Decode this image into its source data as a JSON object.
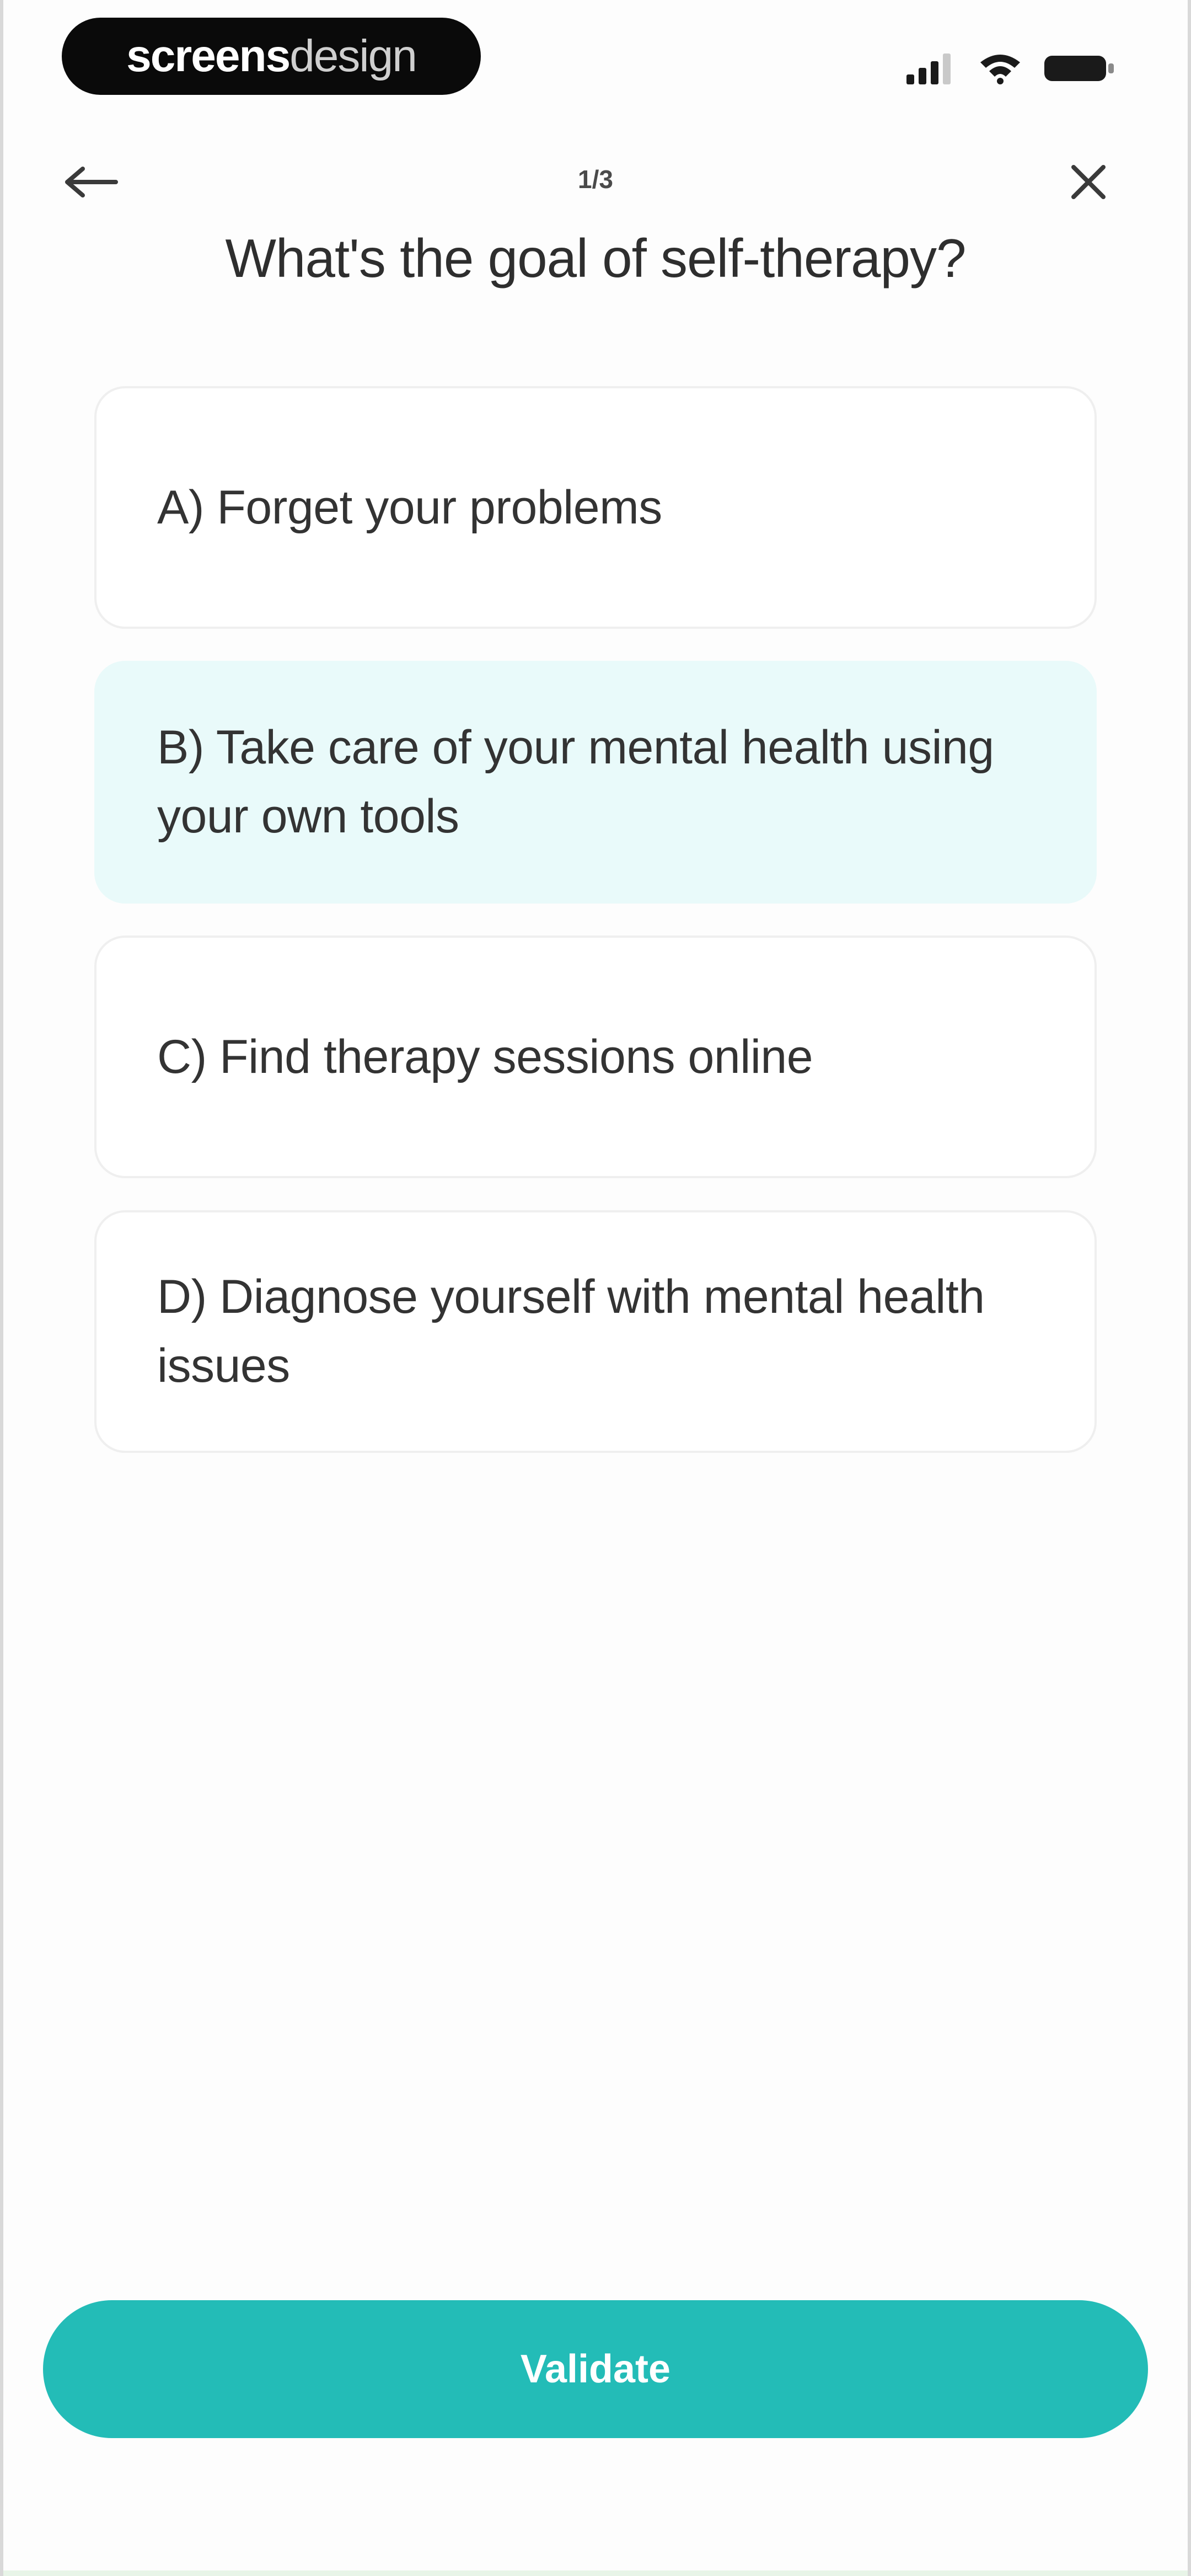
{
  "status_bar": {
    "watermark_part1": "screens",
    "watermark_part2": "design",
    "icons": [
      "signal-icon",
      "wifi-icon",
      "battery-icon"
    ]
  },
  "header": {
    "back_icon": "arrow-left-icon",
    "close_icon": "close-icon",
    "progress": "1/3"
  },
  "question": "What's the goal of self-therapy?",
  "options": [
    {
      "label": "A) Forget your problems",
      "selected": false
    },
    {
      "label": "B) Take care of your mental health using your own tools",
      "selected": true
    },
    {
      "label": "C) Find therapy sessions online",
      "selected": false
    },
    {
      "label": "D) Diagnose yourself with mental health issues",
      "selected": false
    }
  ],
  "validate_label": "Validate",
  "colors": {
    "accent": "#23bcb7",
    "selected_bg": "#e9fafa",
    "text": "#333333"
  }
}
